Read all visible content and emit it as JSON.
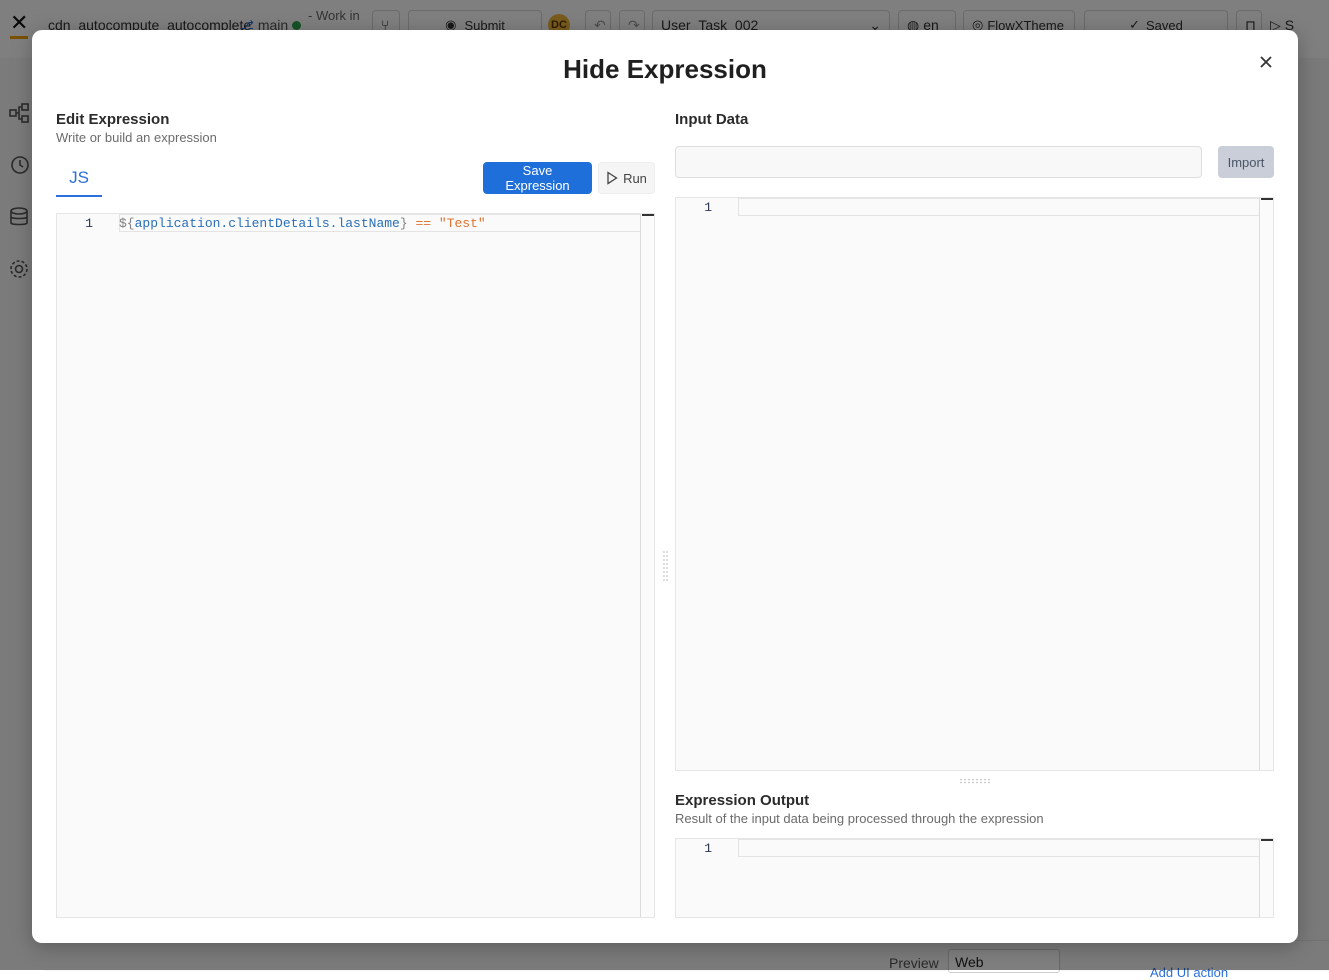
{
  "background": {
    "project_name": "cdn_autocompute_autocomplete",
    "branch": "main",
    "work_in": "- Work in",
    "submit_label": "Submit",
    "avatar_initials": "DC",
    "task_select": "User_Task_002",
    "language": "en",
    "theme": "FlowXTheme",
    "saved_label": "Saved",
    "preview_label": "Preview",
    "platform_select": "Web",
    "add_ui_action": "Add UI action",
    "right_cut_label": "S"
  },
  "modal": {
    "title": "Hide Expression",
    "edit": {
      "title": "Edit Expression",
      "subtitle": "Write or build an expression",
      "tab_js": "JS",
      "save_label": "Save Expression",
      "run_label": "Run",
      "line_number": "1",
      "code": {
        "open": "${",
        "path": "application.clientDetails.lastName",
        "close": "}",
        "op": "==",
        "str": "\"Test\""
      }
    },
    "input": {
      "title": "Input Data",
      "import_label": "Import",
      "line_number": "1"
    },
    "output": {
      "title": "Expression Output",
      "subtitle": "Result of the input data being processed through the expression",
      "line_number": "1"
    }
  },
  "colors": {
    "accent": "#1e6fd9",
    "overlay": "rgba(0,0,0,0.5)",
    "string_token": "#e0732f",
    "variable_token": "#2a6fb8"
  },
  "icons": [
    "close-icon",
    "play-icon",
    "git-branch-icon",
    "globe-icon",
    "palette-icon",
    "check-circle-icon",
    "undo-icon",
    "redo-icon",
    "flow-icon",
    "history-icon",
    "database-icon",
    "gear-icon"
  ]
}
